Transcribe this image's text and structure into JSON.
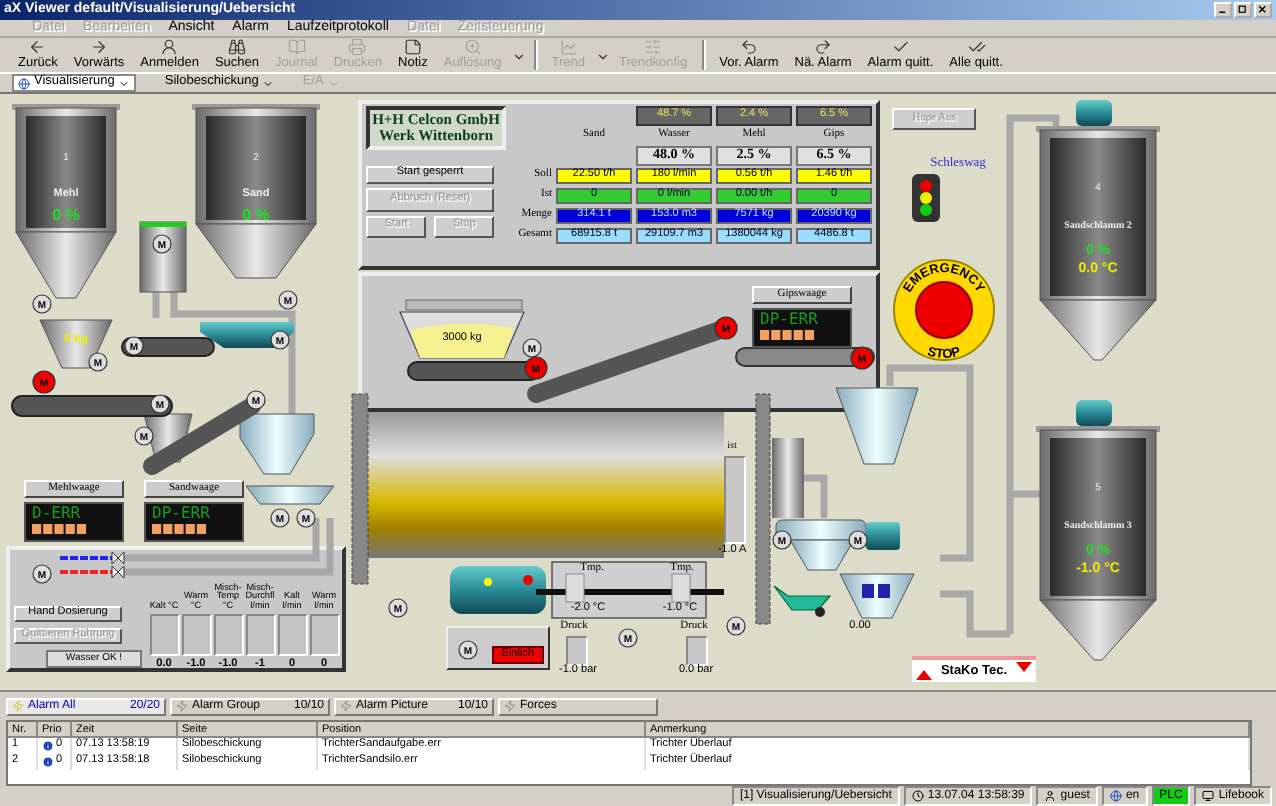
{
  "window": {
    "title": "aX Viewer default/Visualisierung/Uebersicht"
  },
  "menu": [
    {
      "label": "Datei",
      "disabled": true
    },
    {
      "label": "Bearbeiten",
      "disabled": true
    },
    {
      "label": "Ansicht",
      "disabled": false
    },
    {
      "label": "Alarm",
      "disabled": false
    },
    {
      "label": "Laufzeitprotokoll",
      "disabled": false
    },
    {
      "label": "Datei",
      "disabled": true
    },
    {
      "label": "Zeitsteuerung",
      "disabled": true
    }
  ],
  "toolbar": [
    {
      "kind": "back",
      "label": "Zurück",
      "disabled": false
    },
    {
      "kind": "forward",
      "label": "Vorwärts",
      "disabled": false
    },
    {
      "kind": "login",
      "label": "Anmelden",
      "disabled": false
    },
    {
      "kind": "search",
      "label": "Suchen",
      "disabled": false
    },
    {
      "kind": "journal",
      "label": "Journal",
      "disabled": true
    },
    {
      "kind": "print",
      "label": "Drucken",
      "disabled": true
    },
    {
      "kind": "note",
      "label": "Notiz",
      "disabled": false
    },
    {
      "kind": "resolution",
      "label": "Auflösung",
      "disabled": true,
      "dropdown": true
    },
    {
      "kind": "trend",
      "label": "Trend",
      "disabled": true,
      "dropdown": true
    },
    {
      "kind": "trendconfig",
      "label": "Trendkonfig",
      "disabled": true
    },
    {
      "kind": "prevalarm",
      "label": "Vor. Alarm",
      "disabled": false
    },
    {
      "kind": "nextalarm",
      "label": "Nä. Alarm",
      "disabled": false
    },
    {
      "kind": "ack",
      "label": "Alarm quitt.",
      "disabled": false
    },
    {
      "kind": "ackall",
      "label": "Alle quitt.",
      "disabled": false
    }
  ],
  "navigation": [
    {
      "label": "Visualisierung",
      "disabled": false
    },
    {
      "label": "Silobeschickung",
      "disabled": false
    },
    {
      "label": "E/A",
      "disabled": true
    }
  ],
  "plant": {
    "silos": [
      {
        "number": "1",
        "name": "Mehl",
        "level_text": "0 %"
      },
      {
        "number": "2",
        "name": "Sand",
        "level_text": "0 %"
      }
    ],
    "flour_scale_weight": "0 kg",
    "company": [
      "H+H Celcon GmbH",
      "Werk Wittenborn"
    ],
    "control_buttons": [
      {
        "label": "Start gesperrt",
        "disabled": false
      },
      {
        "label": "Abbruch (Reset)",
        "disabled": true
      },
      {
        "label": "Start",
        "disabled": true
      },
      {
        "label": "Stop",
        "disabled": true
      }
    ],
    "dosing": {
      "columns": [
        {
          "name": "Sand"
        },
        {
          "name": "Wasser",
          "actual": "48.7 %",
          "setpoint": "48.0 %"
        },
        {
          "name": "Mehl",
          "actual": "2.4 %",
          "setpoint": "2.5 %"
        },
        {
          "name": "Gips",
          "actual": "6.5 %",
          "setpoint": "6.5 %"
        }
      ],
      "rows": [
        {
          "label": "Soll",
          "color": "#ffff00",
          "values": [
            "22.50 t/h",
            "180 l/min",
            "0.56 t/h",
            "1.46 t/h"
          ]
        },
        {
          "label": "Ist",
          "color": "#33cc33",
          "values": [
            "0",
            "0 l/min",
            "0.00 t/h",
            "0"
          ]
        },
        {
          "label": "Menge",
          "color": "#0000dd",
          "values": [
            "314.1 t",
            "153.0 m3",
            "7571 kg",
            "20390 kg"
          ]
        },
        {
          "label": "Gesamt",
          "color": "#99ddff",
          "values": [
            "68915.8 t",
            "29109.7 m3",
            "1380044 kg",
            "4486.8 t"
          ]
        }
      ]
    },
    "hopper_weight": "3000 kg",
    "scales": [
      {
        "name": "Mehlwaage",
        "display": "D-ERR"
      },
      {
        "name": "Sandwaage",
        "display": "DP-ERR"
      },
      {
        "name": "Gipswaage",
        "display": "DP-ERR"
      }
    ],
    "horn_button": {
      "label": "Hupe Aus",
      "disabled": true
    },
    "traffic_light_label": "Schleswag",
    "emergency_stop": [
      "EMERGENCY",
      "STOP"
    ],
    "tanks": [
      {
        "number": "4",
        "name": "Sandschlamm 2",
        "level_text": "0 %",
        "temperature": "0.0 °C"
      },
      {
        "number": "5",
        "name": "Sandschlamm 3",
        "level_text": "0 %",
        "temperature": "-1.0 °C"
      }
    ],
    "water_panel": {
      "buttons": [
        {
          "label": "Hand Dosierung",
          "disabled": false
        },
        {
          "label": "Quittieren Rührung",
          "disabled": true
        }
      ],
      "status": "Wasser OK !",
      "sensors": [
        {
          "label": "Kalt °C",
          "value": "0.0"
        },
        {
          "label": "Warm °C",
          "value": "-1.0"
        },
        {
          "label": "Misch-Temp °C",
          "value": "-1.0"
        },
        {
          "label": "Misch-Durchfl l/min",
          "value": "-1"
        },
        {
          "label": "Kalt l/min",
          "value": "0"
        },
        {
          "label": "Warm l/min",
          "value": "0"
        }
      ]
    },
    "drum_current": {
      "label": "ist",
      "value": "-1.0 A"
    },
    "temperatures": [
      {
        "label": "Tmp.",
        "value": "-2.0 °C"
      },
      {
        "label": "Tmp.",
        "value": "-1.0 °C"
      }
    ],
    "pressures": [
      {
        "label": "Druck",
        "value": "-1.0 bar"
      },
      {
        "label": "Druck",
        "value": "0.0 bar"
      }
    ],
    "motor_status": "Einlich",
    "mixer_reading": "0.00",
    "logo": "StaKo Tec.",
    "motors": [
      {
        "label": "M",
        "fault": false
      },
      {
        "label": "M",
        "fault": false
      },
      {
        "label": "M",
        "fault": false
      },
      {
        "label": "M",
        "fault": false
      },
      {
        "label": "M",
        "fault": true
      },
      {
        "label": "M",
        "fault": false
      },
      {
        "label": "M",
        "fault": false
      },
      {
        "label": "M",
        "fault": false
      },
      {
        "label": "M",
        "fault": false
      },
      {
        "label": "M",
        "fault": false
      },
      {
        "label": "M",
        "fault": false
      },
      {
        "label": "M",
        "fault": true
      },
      {
        "label": "M",
        "fault": true
      },
      {
        "label": "M",
        "fault": true
      },
      {
        "label": "M",
        "fault": false
      },
      {
        "label": "M",
        "fault": false
      },
      {
        "label": "M",
        "fault": false
      },
      {
        "label": "M",
        "fault": false
      },
      {
        "label": "M",
        "fault": false
      },
      {
        "label": "M",
        "fault": false
      },
      {
        "label": "M",
        "fault": false
      },
      {
        "label": "M",
        "fault": false
      },
      {
        "label": "M",
        "fault": false
      }
    ]
  },
  "alarms": {
    "tabs": [
      {
        "label": "Alarm All",
        "count": "20/20",
        "selected": true
      },
      {
        "label": "Alarm Group",
        "count": "10/10",
        "selected": false
      },
      {
        "label": "Alarm Picture",
        "count": "10/10",
        "selected": false
      },
      {
        "label": "Forces",
        "selected": false
      }
    ],
    "columns": [
      "Nr.",
      "Prio",
      "Zeit",
      "Seite",
      "Position",
      "Anmerkung"
    ],
    "rows": [
      {
        "nr": "1",
        "prio": "0",
        "time": "07.13 13:58:19",
        "page": "Silobeschickung",
        "position": "TrichterSandaufgabe.err",
        "note": "Trichter Überlauf"
      },
      {
        "nr": "2",
        "prio": "0",
        "time": "07.13 13:58:18",
        "page": "Silobeschickung",
        "position": "TrichterSandsilo.err",
        "note": "Trichter Überlauf"
      }
    ]
  },
  "status_bar": {
    "page": "[1] Visualisierung/Uebersicht",
    "datetime": "13.07.04 13:58:39",
    "user": "guest",
    "language": "en",
    "plc": "PLC",
    "host": "Lifebook"
  }
}
